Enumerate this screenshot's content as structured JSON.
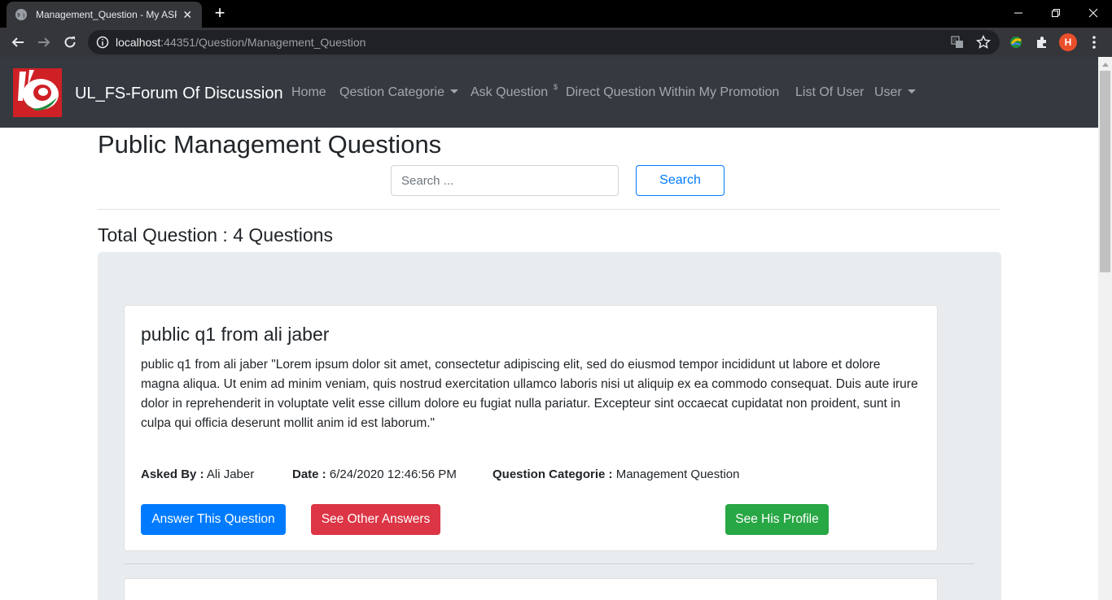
{
  "browser": {
    "tab_title": "Management_Question - My ASP.",
    "url_host": "localhost",
    "url_rest": ":44351/Question/Management_Question",
    "profile_initial": "H"
  },
  "navbar": {
    "brand": "UL_FS-Forum Of Discussion",
    "links": {
      "home": "Home",
      "categorie": "Qestion Categorie",
      "ask": "Ask Question",
      "direct": "Direct Question Within My Promotion",
      "users": "List Of User",
      "user": "User"
    },
    "sup": "$"
  },
  "main": {
    "title": "Public Management Questions",
    "search_placeholder": "Search ...",
    "search_button": "Search",
    "total": "Total Question : 4 Questions"
  },
  "questions": [
    {
      "title": "public q1 from ali jaber",
      "body": "public q1 from ali jaber \"Lorem ipsum dolor sit amet, consectetur adipiscing elit, sed do eiusmod tempor incididunt ut labore et dolore magna aliqua. Ut enim ad minim veniam, quis nostrud exercitation ullamco laboris nisi ut aliquip ex ea commodo consequat. Duis aute irure dolor in reprehenderit in voluptate velit esse cillum dolore eu fugiat nulla pariatur. Excepteur sint occaecat cupidatat non proident, sunt in culpa qui officia deserunt mollit anim id est laborum.\"",
      "asked_by_label": "Asked By :",
      "asked_by": " Ali Jaber",
      "date_label": "Date :",
      "date": " 6/24/2020 12:46:56 PM",
      "category_label": "Question Categorie :",
      "category": " Management Question",
      "answer_button": "Answer This Question",
      "other_answers_button": "See Other Answers",
      "profile_button": "See His Profile"
    }
  ],
  "colors": {
    "primary": "#007bff",
    "danger": "#dc3545",
    "success": "#28a745",
    "navbar": "#343a40",
    "jumbotron": "#e9ecef"
  }
}
